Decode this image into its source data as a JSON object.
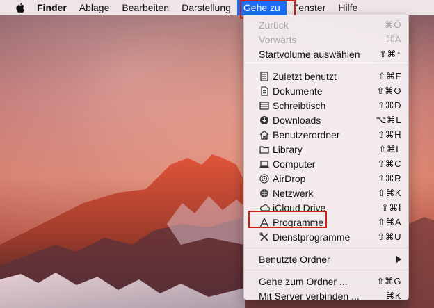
{
  "menubar": {
    "apple_icon": "apple-logo-icon",
    "items": [
      {
        "label": "Finder"
      },
      {
        "label": "Ablage"
      },
      {
        "label": "Bearbeiten"
      },
      {
        "label": "Darstellung"
      },
      {
        "label": "Gehe zu"
      },
      {
        "label": "Fenster"
      },
      {
        "label": "Hilfe"
      }
    ],
    "active_color": "#1b6ef5"
  },
  "menu": {
    "group1": [
      {
        "label": "Zurück",
        "shortcut": "⌘Ö"
      },
      {
        "label": "Vorwärts",
        "shortcut": "⌘Ä"
      },
      {
        "label": "Startvolume auswählen",
        "shortcut": "⇧⌘↑"
      }
    ],
    "group2": [
      {
        "label": "Zuletzt benutzt",
        "shortcut": "⇧⌘F",
        "icon": "recent-items-icon"
      },
      {
        "label": "Dokumente",
        "shortcut": "⇧⌘O",
        "icon": "documents-icon"
      },
      {
        "label": "Schreibtisch",
        "shortcut": "⇧⌘D",
        "icon": "desktop-icon"
      },
      {
        "label": "Downloads",
        "shortcut": "⌥⌘L",
        "icon": "downloads-icon"
      },
      {
        "label": "Benutzerordner",
        "shortcut": "⇧⌘H",
        "icon": "home-icon"
      },
      {
        "label": "Library",
        "shortcut": "⇧⌘L",
        "icon": "folder-icon"
      },
      {
        "label": "Computer",
        "shortcut": "⇧⌘C",
        "icon": "computer-icon"
      },
      {
        "label": "AirDrop",
        "shortcut": "⇧⌘R",
        "icon": "airdrop-icon"
      },
      {
        "label": "Netzwerk",
        "shortcut": "⇧⌘K",
        "icon": "network-icon"
      },
      {
        "label": "iCloud Drive",
        "shortcut": "⇧⌘I",
        "icon": "icloud-icon"
      },
      {
        "label": "Programme",
        "shortcut": "⇧⌘A",
        "icon": "applications-icon"
      },
      {
        "label": "Dienstprogramme",
        "shortcut": "⇧⌘U",
        "icon": "utilities-icon"
      }
    ],
    "group3": [
      {
        "label": "Benutzte Ordner"
      }
    ],
    "group4": [
      {
        "label": "Gehe zum Ordner ...",
        "shortcut": "⇧⌘G"
      },
      {
        "label": "Mit Server verbinden ...",
        "shortcut": "⌘K"
      }
    ]
  },
  "annotation_color": "#c6221c"
}
